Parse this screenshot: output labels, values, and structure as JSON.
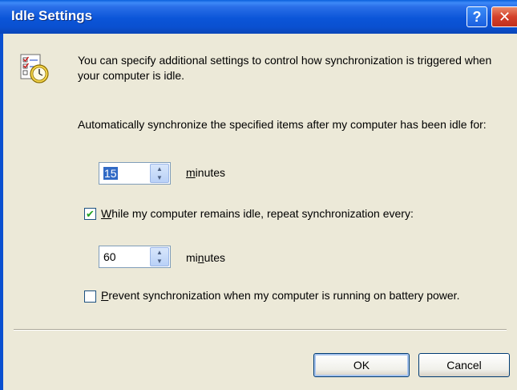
{
  "window": {
    "title": "Idle Settings",
    "help_symbol": "?",
    "close_symbol": "✕"
  },
  "intro": {
    "text": "You can specify additional settings to control how synchronization is triggered when your computer is idle.",
    "icon": "idle-schedule-clock-icon"
  },
  "auto_sync": {
    "text": "Automatically synchronize the specified items after my computer has been idle for:",
    "value": "15",
    "unit_pre": "",
    "unit_underlined": "m",
    "unit_post": "inutes"
  },
  "repeat": {
    "checked": true,
    "label_underlined": "W",
    "label_rest": "hile my computer remains idle, repeat synchronization every:",
    "value": "60",
    "unit_pre": "mi",
    "unit_underlined": "n",
    "unit_post": "utes"
  },
  "battery": {
    "checked": false,
    "label_underlined": "P",
    "label_rest": "revent synchronization when my computer is running on battery power."
  },
  "buttons": {
    "ok": "OK",
    "cancel": "Cancel"
  }
}
